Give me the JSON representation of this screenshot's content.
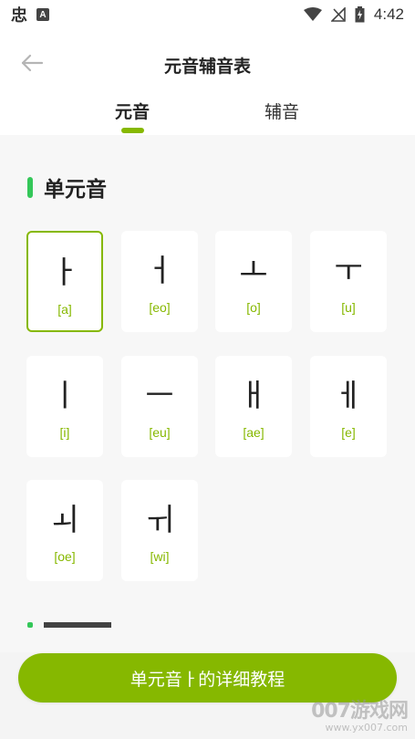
{
  "status_bar": {
    "time": "4:42",
    "left_icons": [
      "app-notification-icon",
      "a-icon"
    ],
    "app_glyph": "忠",
    "badge_letter": "A",
    "right_icons": [
      "wifi-icon",
      "no-signal-icon",
      "battery-charging-icon"
    ]
  },
  "header": {
    "title": "元音辅音表",
    "back_icon": "arrow-left-icon"
  },
  "tabs": [
    {
      "label": "元音",
      "active": true
    },
    {
      "label": "辅音",
      "active": false
    }
  ],
  "section": {
    "title": "单元音",
    "items": [
      {
        "glyph": "ㅏ",
        "roman": "[a]",
        "selected": true
      },
      {
        "glyph": "ㅓ",
        "roman": "[eo]",
        "selected": false
      },
      {
        "glyph": "ㅗ",
        "roman": "[o]",
        "selected": false
      },
      {
        "glyph": "ㅜ",
        "roman": "[u]",
        "selected": false
      },
      {
        "glyph": "ㅣ",
        "roman": "[i]",
        "selected": false
      },
      {
        "glyph": "ㅡ",
        "roman": "[eu]",
        "selected": false
      },
      {
        "glyph": "ㅐ",
        "roman": "[ae]",
        "selected": false
      },
      {
        "glyph": "ㅔ",
        "roman": "[e]",
        "selected": false
      },
      {
        "glyph": "ㅚ",
        "roman": "[oe]",
        "selected": false
      },
      {
        "glyph": "ㅟ",
        "roman": "[wi]",
        "selected": false
      }
    ]
  },
  "cta": {
    "label": "单元音ㅏ的详细教程"
  },
  "watermark": {
    "main": "007游戏网",
    "url": "www.yx007.com"
  },
  "colors": {
    "accent": "#86b800",
    "section_bar": "#34c759",
    "background": "#f7f7f7"
  }
}
